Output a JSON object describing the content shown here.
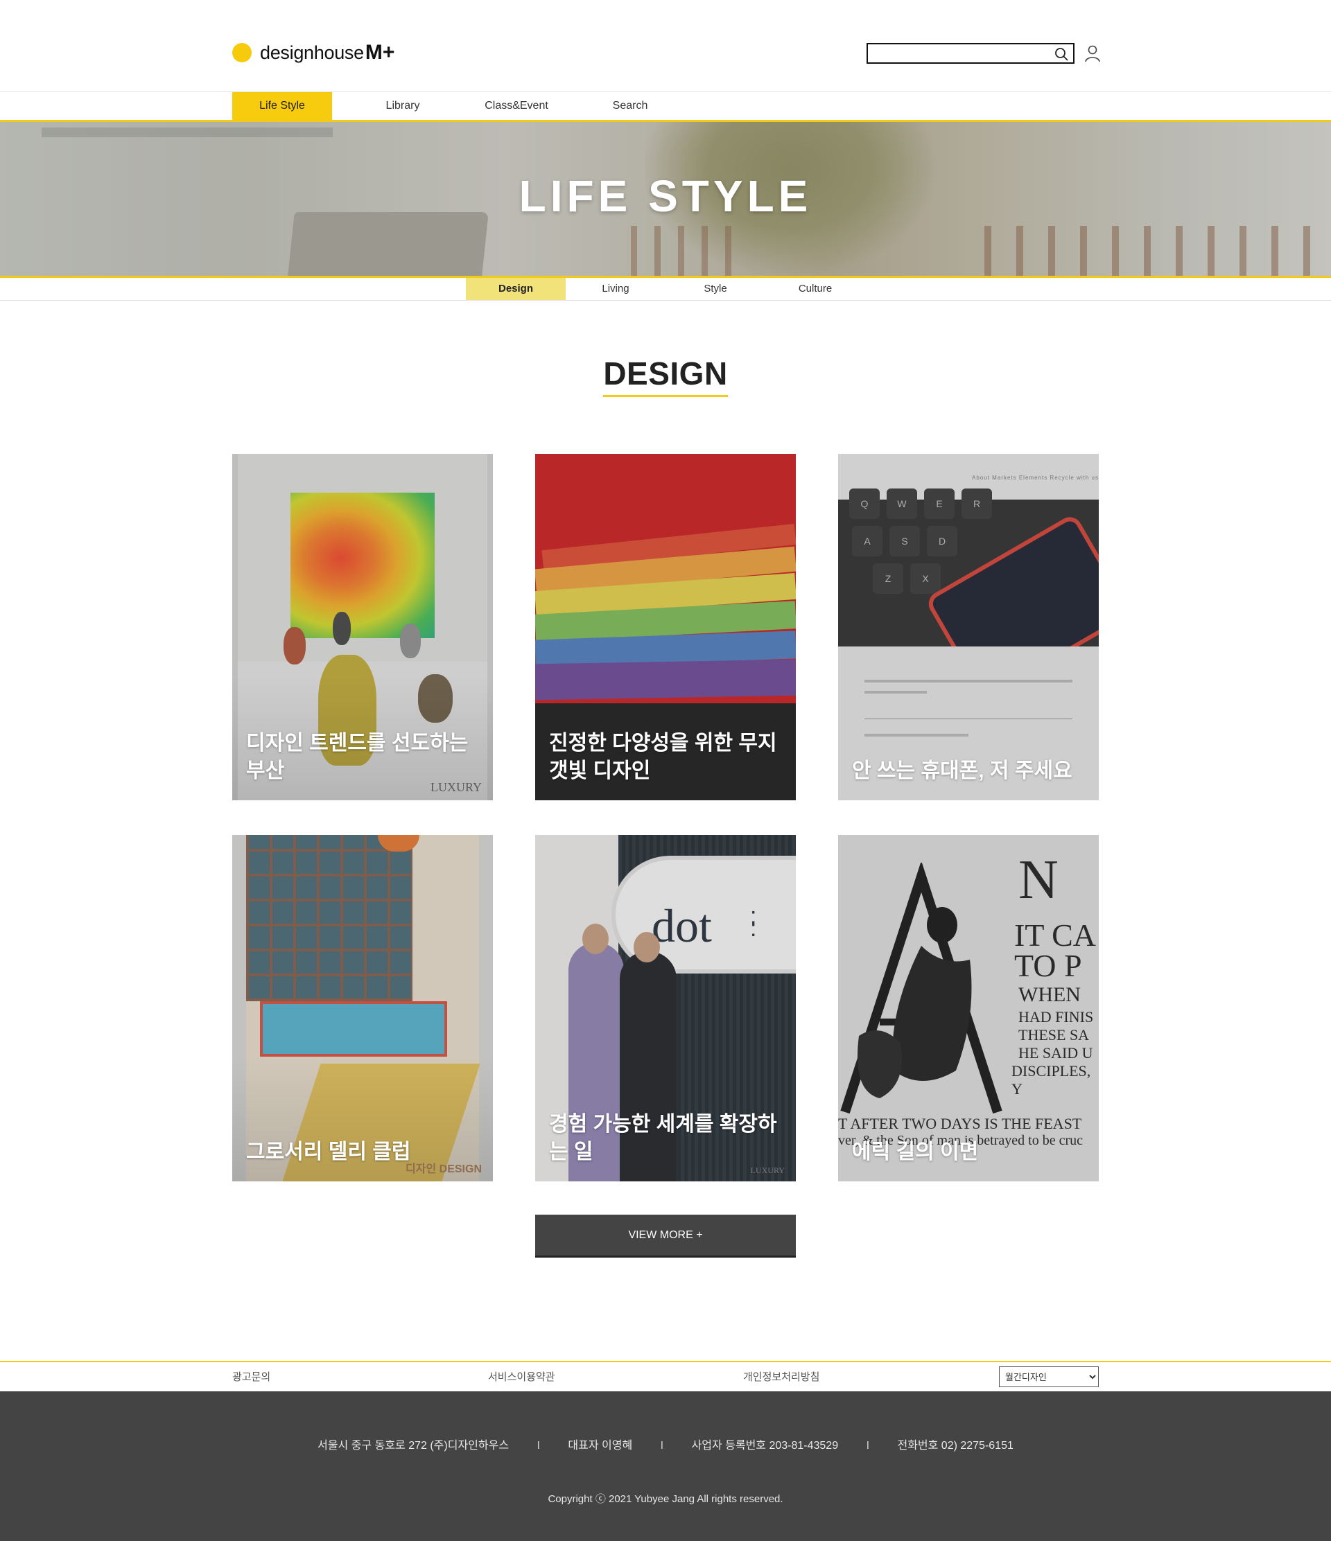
{
  "header": {
    "logo_text": "designhouse",
    "logo_plus": "M+",
    "search_placeholder": "",
    "search_icon": "search-icon",
    "user_icon": "user-icon",
    "accent_color": "#f6cb0c"
  },
  "gnb": {
    "items": [
      {
        "label": "Life Style",
        "active": true
      },
      {
        "label": "Library",
        "active": false
      },
      {
        "label": "Class&Event",
        "active": false
      },
      {
        "label": "Search",
        "active": false
      }
    ]
  },
  "hero": {
    "title": "LIFE STYLE"
  },
  "subnav": {
    "items": [
      {
        "label": "Design",
        "active": true
      },
      {
        "label": "Living",
        "active": false
      },
      {
        "label": "Style",
        "active": false
      },
      {
        "label": "Culture",
        "active": false
      }
    ]
  },
  "section": {
    "title": "DESIGN"
  },
  "cards": [
    {
      "title": "디자인 트렌드를 선도하는 부산",
      "mark": "LUXURY"
    },
    {
      "title": "진정한 다양성을 위한 무지갯빛 디자인",
      "mark": ""
    },
    {
      "title": "안 쓰는 휴대폰, 저 주세요",
      "mark": ""
    },
    {
      "title": "그로서리 델리 클럽",
      "mark": "디자인 DESIGN"
    },
    {
      "title": "경험 가능한 세계를 확장하는 일",
      "mark": "LUXURY"
    },
    {
      "title": "에릭 길의 이면",
      "mark": ""
    }
  ],
  "card_details": {
    "card3_nav": "About  Markets  Elements  Recycle with us",
    "card3_keys": [
      "Q",
      "W",
      "E",
      "R",
      "A",
      "S",
      "D",
      "Z",
      "X"
    ],
    "card5_sign": "dot",
    "card6_text": [
      "IT CA",
      "TO P",
      "WHEN",
      "HAD FINIS",
      "THESE SA",
      "HE SAID U",
      "DISCIPLES, Y",
      "T AFTER TWO DAYS IS THE FEAST",
      "ver, & the Son of man is betrayed to be cruc"
    ]
  },
  "view_more": {
    "label": "VIEW MORE +"
  },
  "footer": {
    "links": [
      "광고문의",
      "서비스이용약관",
      "개인정보처리방침"
    ],
    "family_select": {
      "selected": "월간디자인",
      "options": [
        "월간디자인"
      ]
    },
    "info": [
      "서울시 중구 동호로 272 (주)디자인하우스",
      "대표자 이영혜",
      "사업자 등록번호 203-81-43529",
      "전화번호 02) 2275-6151"
    ],
    "separator": "I",
    "copyright": "Copyright ⓒ 2021 Yubyee Jang All rights reserved."
  }
}
